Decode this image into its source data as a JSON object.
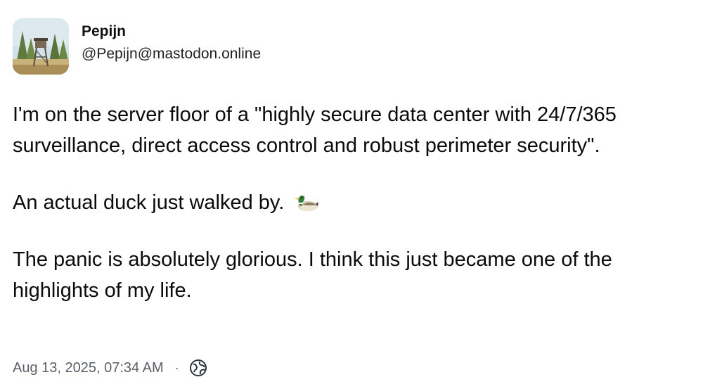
{
  "author": {
    "display_name": "Pepijn",
    "handle": "@Pepijn@mastodon.online",
    "avatar_icon": "avatar-photo-watchtower"
  },
  "post": {
    "paragraphs": [
      "I'm on the server floor of a \"highly secure data center with 24/7/365 surveillance, direct access control and robust perimeter security\".",
      "An actual duck just walked by.",
      "The panic is absolutely glorious. I think this just became one of the highlights of my life."
    ],
    "emoji": "duck-emoji"
  },
  "meta": {
    "timestamp": "Aug 13, 2025, 07:34 AM",
    "separator": "·",
    "visibility_icon": "globe-icon"
  }
}
